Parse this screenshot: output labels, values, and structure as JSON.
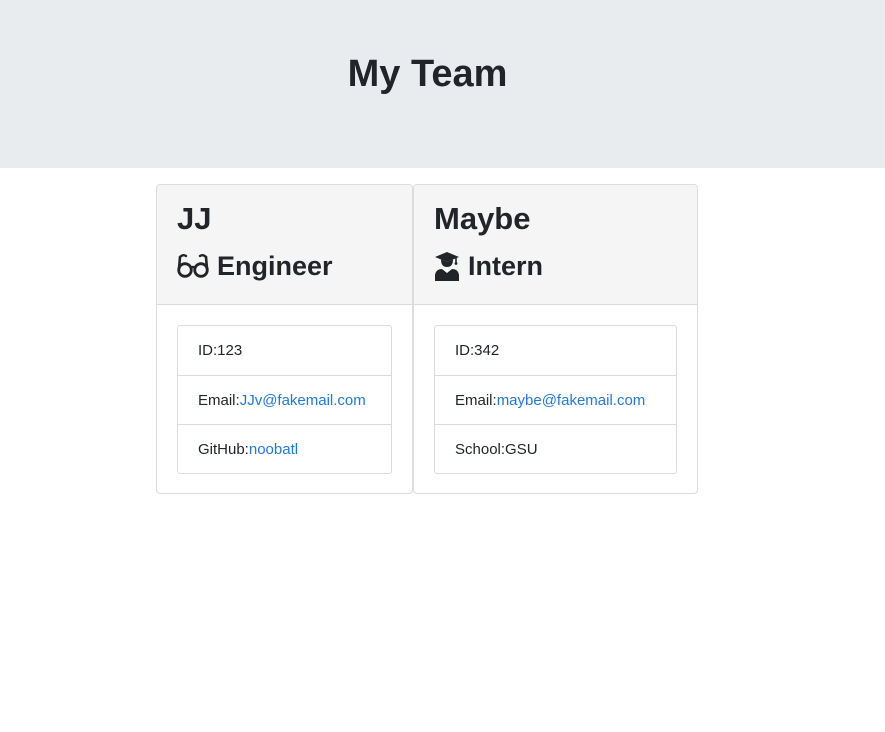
{
  "header": {
    "title": "My Team"
  },
  "cards": [
    {
      "name": "JJ",
      "role": "Engineer",
      "role_icon": "glasses-icon",
      "details": [
        {
          "label": "ID: ",
          "value": "123"
        },
        {
          "label": "Email: ",
          "value": "JJv@fakemail.com"
        },
        {
          "label": "GitHub: ",
          "value": "noobatl"
        }
      ]
    },
    {
      "name": "Maybe",
      "role": "Intern",
      "role_icon": "graduate-icon",
      "details": [
        {
          "label": "ID: ",
          "value": "342"
        },
        {
          "label": "Email: ",
          "value": "maybe@fakemail.com"
        },
        {
          "label": "School: ",
          "value": "GSU"
        }
      ]
    }
  ],
  "colors": {
    "header_bg": "#e9ecef",
    "card_header_bg": "#f5f5f5",
    "link": "#1f7ae0",
    "text": "#212529"
  }
}
